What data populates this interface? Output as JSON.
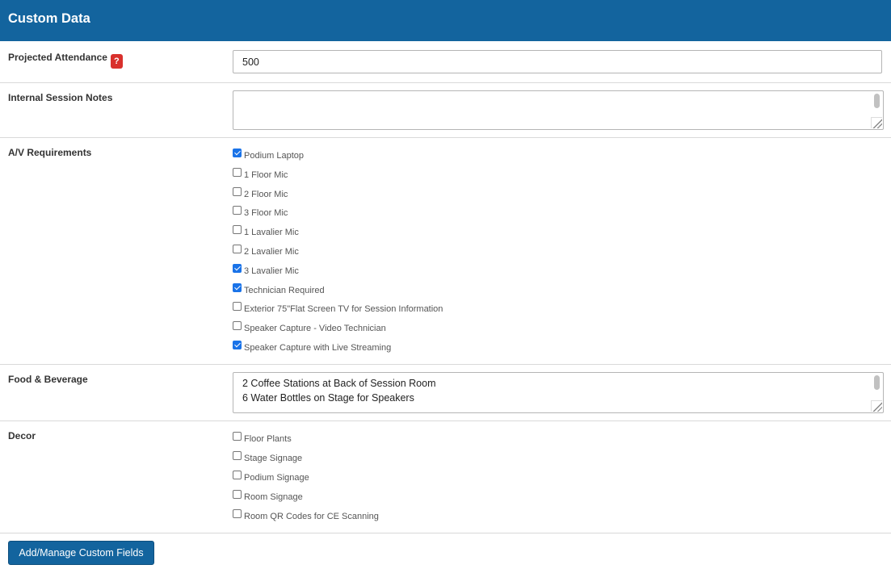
{
  "header": {
    "title": "Custom Data"
  },
  "fields": {
    "projected_attendance": {
      "label": "Projected Attendance",
      "help": "?",
      "value": "500"
    },
    "internal_session_notes": {
      "label": "Internal Session Notes",
      "lines": []
    },
    "av_requirements": {
      "label": "A/V Requirements",
      "options": [
        {
          "label": "Podium Laptop",
          "checked": true
        },
        {
          "label": "1 Floor Mic",
          "checked": false
        },
        {
          "label": "2 Floor Mic",
          "checked": false
        },
        {
          "label": "3 Floor Mic",
          "checked": false
        },
        {
          "label": "1 Lavalier Mic",
          "checked": false
        },
        {
          "label": "2 Lavalier Mic",
          "checked": false
        },
        {
          "label": "3 Lavalier Mic",
          "checked": true
        },
        {
          "label": "Technician Required",
          "checked": true
        },
        {
          "label": "Exterior 75\"Flat Screen TV for Session Information",
          "checked": false
        },
        {
          "label": "Speaker Capture - Video Technician",
          "checked": false
        },
        {
          "label": "Speaker Capture with Live Streaming",
          "checked": true
        }
      ]
    },
    "food_beverage": {
      "label": "Food & Beverage",
      "lines": [
        "2 Coffee Stations at Back of Session Room",
        "6 Water Bottles on Stage for Speakers"
      ]
    },
    "decor": {
      "label": "Decor",
      "options": [
        {
          "label": "Floor Plants",
          "checked": false
        },
        {
          "label": "Stage Signage",
          "checked": false
        },
        {
          "label": "Podium Signage",
          "checked": false
        },
        {
          "label": "Room Signage",
          "checked": false
        },
        {
          "label": "Room QR Codes for CE Scanning",
          "checked": false
        }
      ]
    }
  },
  "actions": {
    "manage_button": "Add/Manage Custom Fields"
  },
  "colors": {
    "header": "#13649e",
    "help_badge": "#d9302c",
    "checkbox_checked": "#1a73e8"
  }
}
